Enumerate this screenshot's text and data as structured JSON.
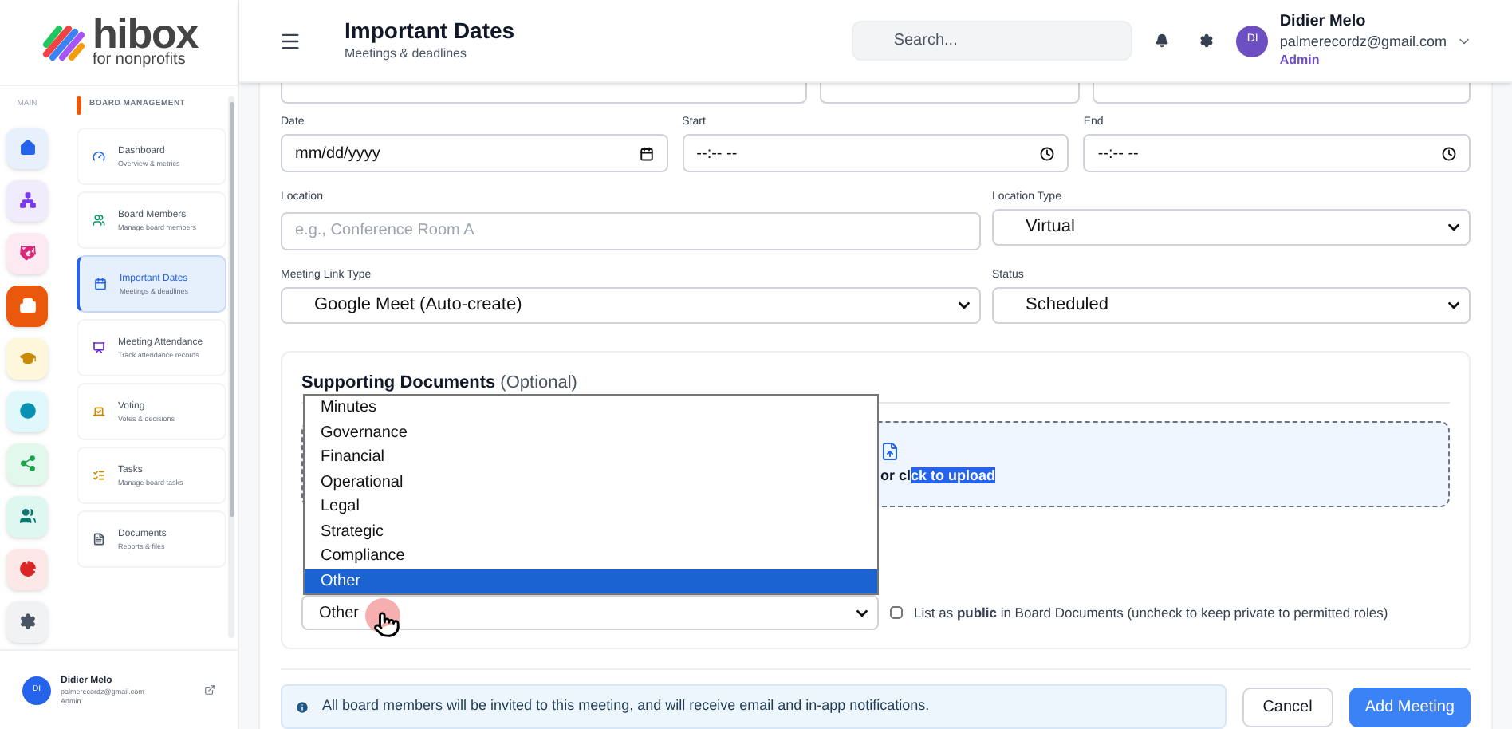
{
  "brand": {
    "name": "hibox",
    "tagline": "for nonprofits"
  },
  "rail": {
    "label": "MAIN",
    "items": [
      {
        "selected": false
      },
      {
        "selected": false
      },
      {
        "selected": false
      },
      {
        "selected": true
      },
      {
        "selected": false
      },
      {
        "selected": false
      },
      {
        "selected": false
      },
      {
        "selected": false
      },
      {
        "selected": false
      },
      {
        "selected": false
      }
    ]
  },
  "nav": {
    "section": "BOARD MANAGEMENT",
    "items": [
      {
        "title": "Dashboard",
        "subtitle": "Overview & metrics",
        "selected": false
      },
      {
        "title": "Board Members",
        "subtitle": "Manage board members",
        "selected": false
      },
      {
        "title": "Important Dates",
        "subtitle": "Meetings & deadlines",
        "selected": true
      },
      {
        "title": "Meeting Attendance",
        "subtitle": "Track attendance records",
        "selected": false
      },
      {
        "title": "Voting",
        "subtitle": "Votes & decisions",
        "selected": false
      },
      {
        "title": "Tasks",
        "subtitle": "Manage board tasks",
        "selected": false
      },
      {
        "title": "Documents",
        "subtitle": "Reports & files",
        "selected": false
      }
    ]
  },
  "sidebar_user": {
    "initials": "DI",
    "name": "Didier Melo",
    "email": "palmerecordz@gmail.com",
    "role": "Admin"
  },
  "header": {
    "title": "Important Dates",
    "subtitle": "Meetings & deadlines",
    "search": {
      "placeholder": "Search..."
    },
    "user": {
      "initials": "DI",
      "name": "Didier Melo",
      "email": "palmerecordz@gmail.com",
      "role": "Admin"
    }
  },
  "form": {
    "date": {
      "label": "Date",
      "placeholder": "mm/dd/yyyy"
    },
    "start": {
      "label": "Start",
      "placeholder": "--:-- --"
    },
    "end": {
      "label": "End",
      "placeholder": "--:-- --"
    },
    "location": {
      "label": "Location",
      "placeholder": "e.g., Conference Room A"
    },
    "location_type": {
      "label": "Location Type",
      "value": "Virtual"
    },
    "meeting_link_type": {
      "label": "Meeting Link Type",
      "value": "Google Meet (Auto-create)"
    },
    "status": {
      "label": "Status",
      "value": "Scheduled"
    },
    "documents": {
      "title": "Supporting Documents",
      "optional": "(Optional)",
      "upload_before": "or cl",
      "upload_selected": "ck to upload",
      "category": {
        "value": "Other",
        "options": [
          {
            "label": "Minutes",
            "selected": false
          },
          {
            "label": "Governance",
            "selected": false
          },
          {
            "label": "Financial",
            "selected": false
          },
          {
            "label": "Operational",
            "selected": false
          },
          {
            "label": "Legal",
            "selected": false
          },
          {
            "label": "Strategic",
            "selected": false
          },
          {
            "label": "Compliance",
            "selected": false
          },
          {
            "label": "Other",
            "selected": true
          }
        ]
      },
      "public": {
        "checked": false,
        "label": "List as **public** in Board Documents (uncheck to keep private to permitted roles)"
      }
    },
    "notice": "All board members will be invited to this meeting, and will receive email and in-app notifications.",
    "buttons": {
      "cancel": "Cancel",
      "submit": "Add Meeting"
    }
  }
}
